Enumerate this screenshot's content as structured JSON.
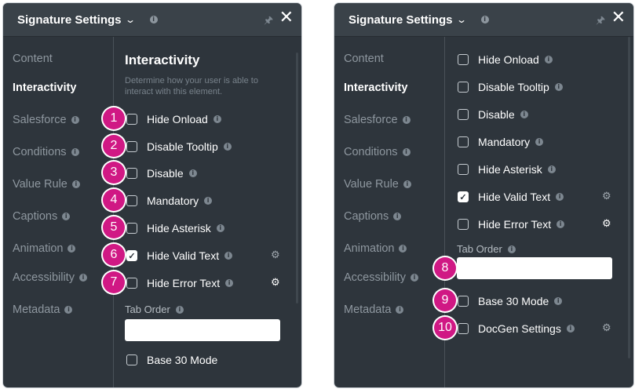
{
  "panel": {
    "title": "Signature Settings",
    "sidebar": [
      {
        "label": "Content",
        "info": false,
        "active": false
      },
      {
        "label": "Interactivity",
        "info": false,
        "active": true
      },
      {
        "label": "Salesforce",
        "info": true,
        "active": false
      },
      {
        "label": "Conditions",
        "info": true,
        "active": false
      },
      {
        "label": "Value Rule",
        "info": true,
        "active": false
      },
      {
        "label": "Captions",
        "info": true,
        "active": false
      },
      {
        "label": "Animation",
        "info": true,
        "active": false
      },
      {
        "label": "Accessibility",
        "info": true,
        "active": false
      },
      {
        "label": "Metadata",
        "info": true,
        "active": false
      }
    ]
  },
  "left": {
    "heading": "Interactivity",
    "description": "Determine how your user is able to interact with this element.",
    "options": [
      {
        "label": "Hide Onload",
        "checked": false,
        "badge": "1",
        "gear": "none"
      },
      {
        "label": "Disable Tooltip",
        "checked": false,
        "badge": "2",
        "gear": "none"
      },
      {
        "label": "Disable",
        "checked": false,
        "badge": "3",
        "gear": "none"
      },
      {
        "label": "Mandatory",
        "checked": false,
        "badge": "4",
        "gear": "none"
      },
      {
        "label": "Hide Asterisk",
        "checked": false,
        "badge": "5",
        "gear": "none"
      },
      {
        "label": "Hide Valid Text",
        "checked": true,
        "badge": "6",
        "gear": "dim"
      },
      {
        "label": "Hide Error Text",
        "checked": false,
        "badge": "7",
        "gear": "bright"
      }
    ],
    "tab_order_label": "Tab Order",
    "tab_order_value": "",
    "partial_option": "Base 30 Mode"
  },
  "right": {
    "options": [
      {
        "label": "Hide Onload",
        "checked": false,
        "gear": "none"
      },
      {
        "label": "Disable Tooltip",
        "checked": false,
        "gear": "none"
      },
      {
        "label": "Disable",
        "checked": false,
        "gear": "none"
      },
      {
        "label": "Mandatory",
        "checked": false,
        "gear": "none"
      },
      {
        "label": "Hide Asterisk",
        "checked": false,
        "gear": "none"
      },
      {
        "label": "Hide Valid Text",
        "checked": true,
        "gear": "dim"
      },
      {
        "label": "Hide Error Text",
        "checked": false,
        "gear": "bright"
      }
    ],
    "tab_order_label": "Tab Order",
    "tab_order_value": "",
    "tab_order_badge": "8",
    "extra_options": [
      {
        "label": "Base 30 Mode",
        "checked": false,
        "badge": "9",
        "gear": "none"
      },
      {
        "label": "DocGen Settings",
        "checked": false,
        "badge": "10",
        "gear": "dim"
      }
    ]
  },
  "icons": {
    "chevron": "chevron-down-icon",
    "pin": "pin-icon",
    "close": "close-icon",
    "gear": "gear-icon",
    "info": "info-icon",
    "check": "check-icon"
  },
  "colors": {
    "panel_bg": "#2e353c",
    "header_bg": "#3a4249",
    "badge": "#d01884",
    "muted_text": "#8e979f"
  }
}
